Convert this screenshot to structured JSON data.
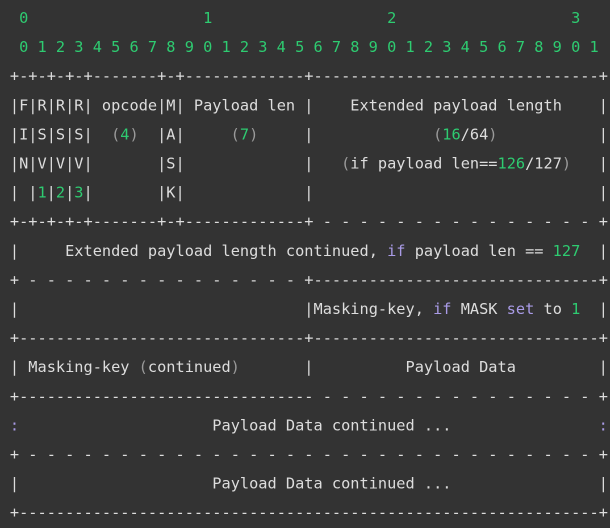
{
  "colors": {
    "background": "#333333",
    "text": "#dddddd",
    "number": "#2ecc71",
    "keyword": "#a99be6",
    "punctuation": "#9a9a9a"
  },
  "diagram": {
    "lines": [
      [
        [
          "   ",
          "text"
        ],
        [
          "0",
          "number"
        ],
        [
          "                   ",
          "text"
        ],
        [
          "1",
          "number"
        ],
        [
          "                   ",
          "text"
        ],
        [
          "2",
          "number"
        ],
        [
          "                   ",
          "text"
        ],
        [
          "3",
          "number"
        ]
      ],
      [
        [
          "   ",
          "text"
        ],
        [
          "0 1 2 3 4 5 6 7 8 9 0 1 2 3 4 5 6 7 8 9 0 1 2 3 4 5 6 7 8 9 0 1",
          "number"
        ]
      ],
      [
        [
          "  +-+-+-+-+-------+-+-------------+-------------------------------+",
          "text"
        ]
      ],
      [
        [
          "  |F|R|R|R| opcode|M| Payload len |    Extended payload length    |",
          "text"
        ]
      ],
      [
        [
          "  |I|S|S|S|  ",
          "text"
        ],
        [
          "(",
          "punctuation"
        ],
        [
          "4",
          "number"
        ],
        [
          ")",
          "punctuation"
        ],
        [
          "  |A|     ",
          "text"
        ],
        [
          "(",
          "punctuation"
        ],
        [
          "7",
          "number"
        ],
        [
          ")",
          "punctuation"
        ],
        [
          "     |             ",
          "text"
        ],
        [
          "(",
          "punctuation"
        ],
        [
          "16",
          "number"
        ],
        [
          "/64",
          "text"
        ],
        [
          ")",
          "punctuation"
        ],
        [
          "           |",
          "text"
        ]
      ],
      [
        [
          "  |N|V|V|V|       |S|             |   ",
          "text"
        ],
        [
          "(",
          "punctuation"
        ],
        [
          "if payload len==",
          "text"
        ],
        [
          "126",
          "number"
        ],
        [
          "/127",
          "text"
        ],
        [
          ")",
          "punctuation"
        ],
        [
          "   |",
          "text"
        ]
      ],
      [
        [
          "  | |",
          "text"
        ],
        [
          "1",
          "number"
        ],
        [
          "|",
          "text"
        ],
        [
          "2",
          "number"
        ],
        [
          "|",
          "text"
        ],
        [
          "3",
          "number"
        ],
        [
          "|       |K|             |                               |",
          "text"
        ]
      ],
      [
        [
          "  +-+-+-+-+-------+-+-------------+ - - - - - - - - - - - - - - - +",
          "text"
        ]
      ],
      [
        [
          "  |     Extended payload length continued, ",
          "text"
        ],
        [
          "if",
          "keyword"
        ],
        [
          " payload len == ",
          "text"
        ],
        [
          "127",
          "number"
        ],
        [
          "  |",
          "text"
        ]
      ],
      [
        [
          "  + - - - - - - - - - - - - - - - +-------------------------------+",
          "text"
        ]
      ],
      [
        [
          "  |                               |Masking-key, ",
          "text"
        ],
        [
          "if",
          "keyword"
        ],
        [
          " MASK ",
          "text"
        ],
        [
          "set",
          "keyword"
        ],
        [
          " to ",
          "text"
        ],
        [
          "1",
          "number"
        ],
        [
          "  |",
          "text"
        ]
      ],
      [
        [
          "  +-------------------------------+-------------------------------+",
          "text"
        ]
      ],
      [
        [
          "  | Masking-key ",
          "text"
        ],
        [
          "(",
          "punctuation"
        ],
        [
          "continued",
          "text"
        ],
        [
          ")",
          "punctuation"
        ],
        [
          "       |          Payload Data         |",
          "text"
        ]
      ],
      [
        [
          "  +-------------------------------- - - - - - - - - - - - - - - - +",
          "text"
        ]
      ],
      [
        [
          "  ",
          "text"
        ],
        [
          ":",
          "keyword"
        ],
        [
          "                     Payload Data continued ...                ",
          "text"
        ],
        [
          ":",
          "keyword"
        ]
      ],
      [
        [
          "  + - - - - - - - - - - - - - - - - - - - - - - - - - - - - - - - +",
          "text"
        ]
      ],
      [
        [
          "  |                     Payload Data continued ...                |",
          "text"
        ]
      ],
      [
        [
          "  +---------------------------------------------------------------+",
          "text"
        ]
      ]
    ]
  }
}
